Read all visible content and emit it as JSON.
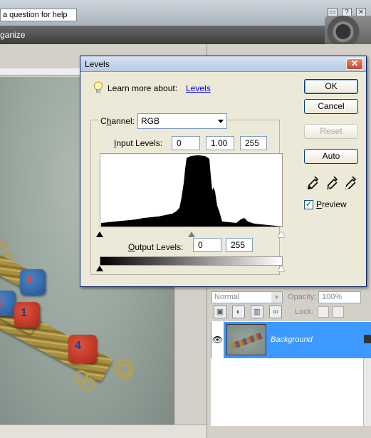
{
  "app": {
    "help_search": "a question for help",
    "menu_organize": "ganize",
    "window_controls": [
      "restore-icon",
      "help-icon",
      "close-icon"
    ]
  },
  "layers_panel": {
    "blend_mode": "Normal",
    "opacity_label": "Opacity:",
    "opacity_value": "100%",
    "lock_label": "Lock:",
    "layer_name": "Background",
    "selected_color": "#3c99ff"
  },
  "dialog": {
    "title": "Levels",
    "learn_more": "Learn more about:",
    "learn_link": "Levels",
    "channel_label": "Channel:",
    "channel_value": "RGB",
    "input_levels_label": "Input Levels:",
    "input_black": "0",
    "input_gamma": "1.00",
    "input_white": "255",
    "output_levels_label": "Output Levels:",
    "output_black": "0",
    "output_white": "255",
    "buttons": {
      "ok": "OK",
      "cancel": "Cancel",
      "reset": "Reset",
      "auto": "Auto"
    },
    "preview_label": "Preview",
    "preview_checked": true,
    "eyedroppers": [
      "black-eyedropper-icon",
      "gray-eyedropper-icon",
      "white-eyedropper-icon"
    ]
  }
}
